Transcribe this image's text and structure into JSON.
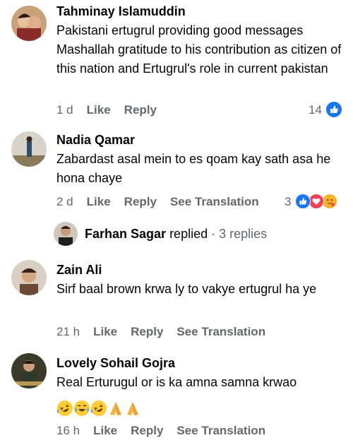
{
  "comments": [
    {
      "name": "Tahminay Islamuddin",
      "text": "Pakistani ertugrul providing good messages Mashallah gratitude to his contribution as citizen of this nation and Ertugrul's role in current pakistan",
      "time": "1 d",
      "like": "Like",
      "reply": "Reply",
      "reaction_count": "14"
    },
    {
      "name": "Nadia Qamar",
      "text": "Zabardast asal mein to es qoam kay sath asa he hona chaye",
      "time": "2 d",
      "like": "Like",
      "reply": "Reply",
      "see_translation": "See Translation",
      "reaction_count": "3"
    },
    {
      "name": "Zain Ali",
      "text": "Sirf baal brown krwa ly to vakye ertugrul ha ye",
      "time": "21 h",
      "like": "Like",
      "reply": "Reply",
      "see_translation": "See Translation"
    },
    {
      "name": "Lovely Sohail Gojra",
      "text": "Real Erturugul or is ka amna samna krwao",
      "time": "16 h",
      "like": "Like",
      "reply": "Reply",
      "see_translation": "See Translation"
    }
  ],
  "replies_row": {
    "name": "Farhan Sagar",
    "action": "replied",
    "separator": "·",
    "count": "3 replies"
  },
  "icons": {
    "like_reaction": "thumbs-up-icon",
    "love_reaction": "heart-icon",
    "care_reaction": "care-emoji-icon",
    "laugh_emoji": "rolling-laughing-emoji-icon",
    "joy_emoji": "tears-of-joy-emoji-icon",
    "pray_emoji": "folded-hands-emoji-icon"
  },
  "colors": {
    "meta_gray": "#65676b",
    "like_blue": "#1877f2",
    "love_red": "#f33e58"
  }
}
